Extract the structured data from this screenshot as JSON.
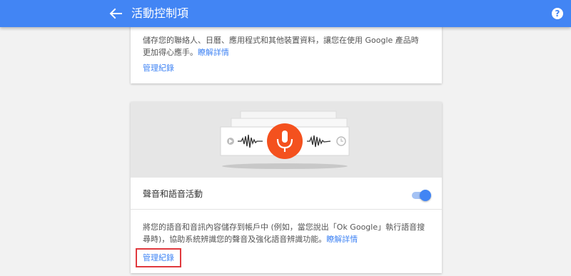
{
  "app_bar": {
    "title": "活動控制項",
    "back_icon": "arrow-back-icon",
    "help_icon": "help-icon",
    "help_glyph": "?",
    "color": "#4285f4"
  },
  "cards": {
    "account_activity": {
      "description": "儲存您的聯絡人、日曆、應用程式和其他裝置資料，讓您在使用 Google 產品時更加得心應手。",
      "learn_more": "瞭解詳情",
      "manage_history": "管理紀錄"
    },
    "voice_activity": {
      "illustration": "voice-recording-illustration",
      "title": "聲音和語音活動",
      "toggle_on": true,
      "description": "將您的語音和音訊內容儲存到帳戶中 (例如，當您說出「Ok Google」執行語音搜尋時)，協助系統辨識您的聲音及強化語音辨識功能。",
      "learn_more": "瞭解詳情",
      "manage_history": "管理紀錄",
      "highlight_color": "#e0393e"
    }
  },
  "colors": {
    "link": "#4285f4",
    "mic": "#f4511e"
  }
}
